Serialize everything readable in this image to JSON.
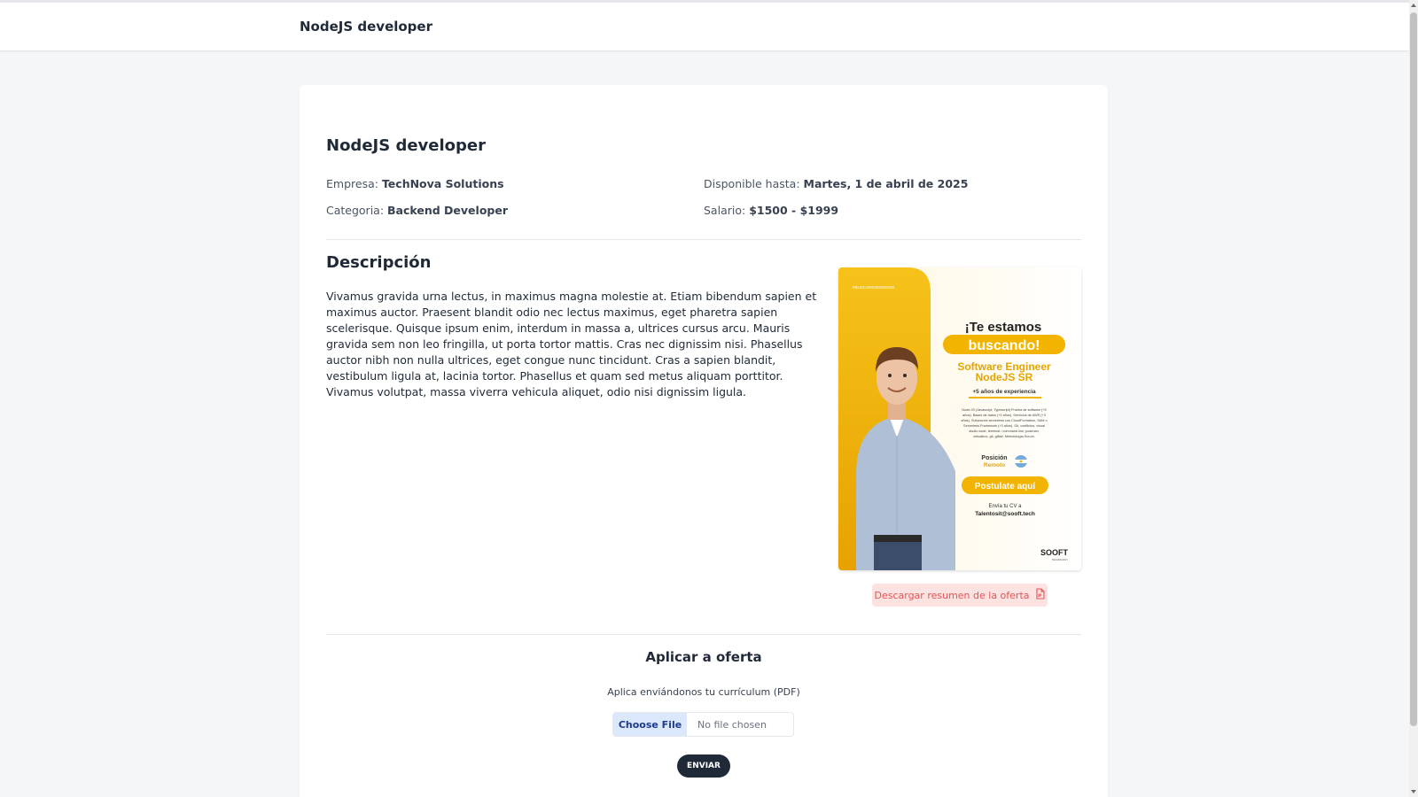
{
  "header": {
    "title": "NodeJS developer"
  },
  "job": {
    "title": "NodeJS developer",
    "empresa_label": "Empresa:",
    "empresa": "TechNova Solutions",
    "disponible_label": "Disponible hasta:",
    "disponible": "Martes, 1 de abril de 2025",
    "categoria_label": "Categoria:",
    "categoria": "Backend Developer",
    "salario_label": "Salario:",
    "salario": "$1500 - $1999"
  },
  "description": {
    "title": "Descripción",
    "text": "Vivamus gravida urna lectus, in maximus magna molestie at. Etiam bibendum sapien et maximus auctor. Praesent blandit odio nec lectus maximus, eget pharetra sapien scelerisque. Quisque ipsum enim, interdum in massa a, ultrices cursus arcu. Mauris gravida sem non leo fringilla, ut porta tortor mattis. Cras nec dignissim nisi. Phasellus auctor nibh non nulla ultrices, eget congue nunc tincidunt. Cras a sapien blandit, vestibulum ligula at, lacinia tortor. Phasellus et quam sed metus aliquam porttitor. Vivamus volutpat, massa viverra vehicula aliquet, odio nisi dignissim ligula."
  },
  "poster": {
    "tag": "#BUSCAMOSINGENIO",
    "headline": "¡Te estamos",
    "headline_pill": "buscando!",
    "role_line1": "Software Engineer",
    "role_line2": "NodeJS SR",
    "experience": "+5 años de experiencia",
    "skills_lines": [
      "Node.JS (Javascript, Typescript) Prueba de software (+5",
      "años). Bases de datos (+3 años). Servicios de AWS (+3",
      "años). Soluciones serverless con CloudFormation, SAM o",
      "Serverless Framework (+3 años). Git, conflictos, visual",
      "studio code, terminal / command line, postman,",
      "virtualbox, git, gitlab. Metodología Scrum."
    ],
    "position_label": "Posición",
    "position_value": "Remoto",
    "cta": "Postulate aquí",
    "send_label": "Envía tu CV a",
    "email": "Talentosit@sooft.tech",
    "brand": "SOOFT",
    "brand_sub": "TECHNOLOGY"
  },
  "download_button": {
    "label": "Descargar resumen de la oferta",
    "icon": "file-pdf-icon"
  },
  "apply": {
    "title": "Aplicar a oferta",
    "subtitle": "Aplica enviándonos tu currículum (PDF)",
    "choose_file": "Choose File",
    "no_file": "No file chosen",
    "submit": "ENVIAR"
  },
  "colors": {
    "accent_yellow": "#f2b400",
    "download_bg": "#fde2e2",
    "download_text": "#e25555",
    "submit_bg": "#1f2937",
    "choose_bg": "#dbe7fb"
  }
}
